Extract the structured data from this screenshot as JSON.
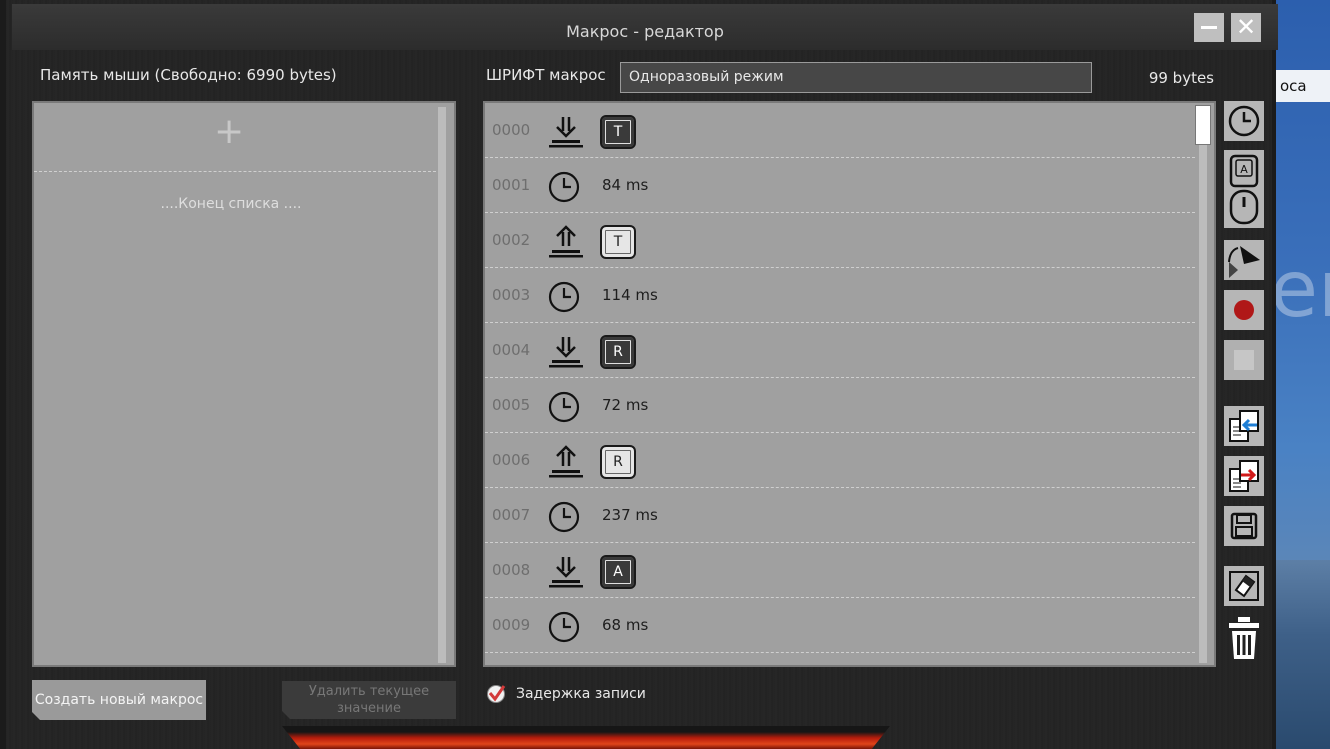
{
  "desktop": {
    "label": "оса",
    "big_text": "en"
  },
  "window": {
    "title": "Макрос - редактор"
  },
  "left": {
    "heading": "Память мыши (Свободно: 6990 bytes)",
    "list_end": "....Конец списка ....",
    "create_button": "Создать новый макрос",
    "delete_button": "Удалить текущее значение"
  },
  "editor": {
    "font_label": "ШРИФТ макрос",
    "mode_value": "Одноразовый режим",
    "bytes": "99 bytes",
    "delay_record_label": "Задержка записи",
    "delay_record_checked": true
  },
  "events": [
    {
      "num": "0000",
      "kind": "key-down",
      "key": "T"
    },
    {
      "num": "0001",
      "kind": "delay",
      "text": "84 ms"
    },
    {
      "num": "0002",
      "kind": "key-up",
      "key": "T"
    },
    {
      "num": "0003",
      "kind": "delay",
      "text": "114 ms"
    },
    {
      "num": "0004",
      "kind": "key-down",
      "key": "R"
    },
    {
      "num": "0005",
      "kind": "delay",
      "text": "72 ms"
    },
    {
      "num": "0006",
      "kind": "key-up",
      "key": "R"
    },
    {
      "num": "0007",
      "kind": "delay",
      "text": "237 ms"
    },
    {
      "num": "0008",
      "kind": "key-down",
      "key": "A"
    },
    {
      "num": "0009",
      "kind": "delay",
      "text": "68 ms"
    }
  ],
  "toolbar": [
    {
      "name": "insert-delay-icon"
    },
    {
      "name": "insert-key-mouse-icon"
    },
    {
      "name": "cursor-icon"
    },
    {
      "name": "record-icon"
    },
    {
      "name": "stop-icon"
    },
    {
      "name": "import-icon"
    },
    {
      "name": "export-icon"
    },
    {
      "name": "save-icon"
    },
    {
      "name": "eraser-icon"
    },
    {
      "name": "trash-icon"
    }
  ],
  "colors": {
    "record": "#b01818",
    "accent_glow": "#e0451a",
    "check": "#d23a3a"
  }
}
